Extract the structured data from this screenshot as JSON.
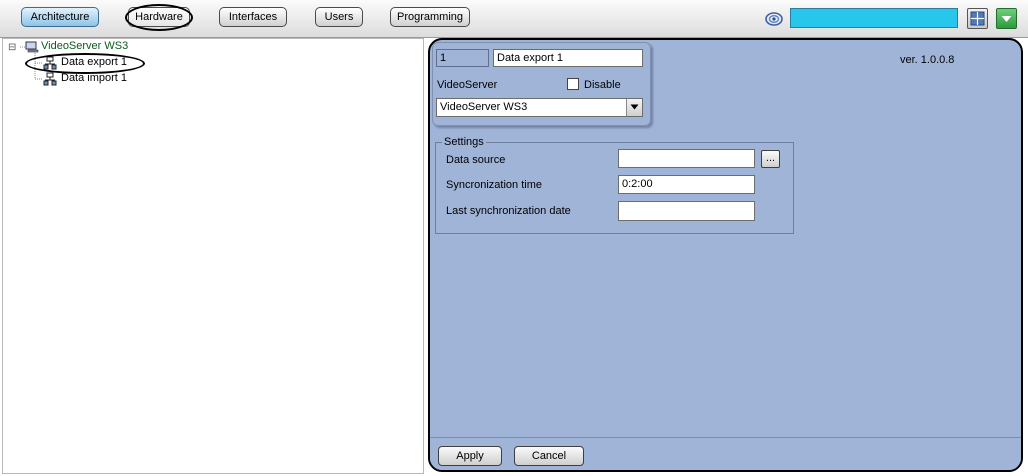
{
  "toolbar": {
    "tabs": [
      {
        "label": "Architecture",
        "state": "active"
      },
      {
        "label": "Hardware",
        "state": "selected"
      },
      {
        "label": "Interfaces"
      },
      {
        "label": "Users"
      },
      {
        "label": "Programming"
      }
    ],
    "search_value": "",
    "search_color": "#28c6ea",
    "icons": [
      "swirl-icon",
      "layout-grid-icon",
      "dropdown-arrow-icon"
    ]
  },
  "tree": {
    "root": {
      "label": "VideoServer WS3",
      "expander": "⊟"
    },
    "children": [
      {
        "label": "Data export 1",
        "selected": true
      },
      {
        "label": "Data import 1"
      }
    ]
  },
  "panel": {
    "id_value": "1",
    "name_value": "Data export 1",
    "parent_label": "VideoServer",
    "disable_label": "Disable",
    "disable_checked": false,
    "parent_select_value": "VideoServer WS3",
    "version": "ver. 1.0.0.8",
    "settings": {
      "legend": "Settings",
      "data_source_label": "Data source",
      "data_source_value": "",
      "browse_label": "...",
      "sync_time_label": "Syncronization time",
      "sync_time_value": "0:2:00",
      "last_sync_label": "Last synchronization date",
      "last_sync_value": ""
    },
    "apply_label": "Apply",
    "cancel_label": "Cancel",
    "background_color": "#a0b4d8"
  }
}
